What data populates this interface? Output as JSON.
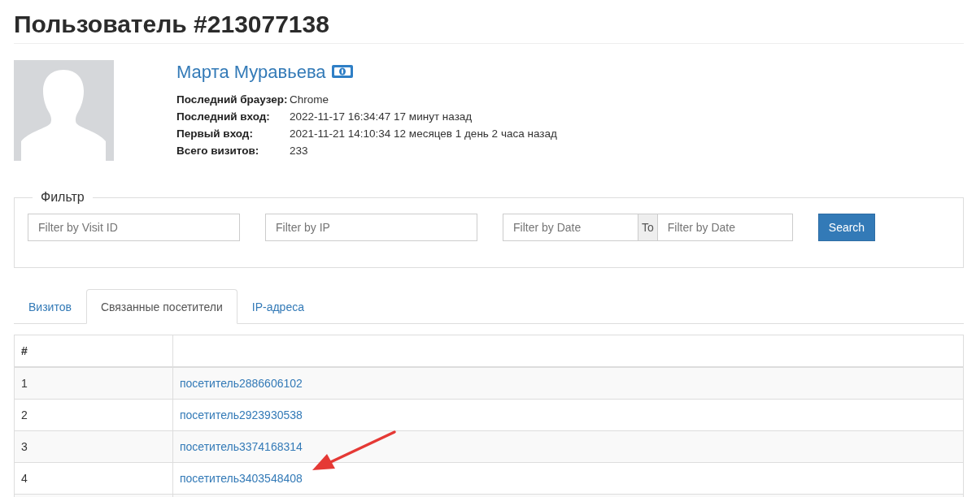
{
  "page_title": "Пользователь #213077138",
  "profile": {
    "name": "Марта Муравьева",
    "details": [
      {
        "label": "Последний браузер:",
        "value": "Chrome"
      },
      {
        "label": "Последний вход:",
        "value": "2022-11-17 16:34:47 17 минут назад"
      },
      {
        "label": "Первый вход:",
        "value": "2021-11-21 14:10:34 12 месяцев 1 день 2 часа назад"
      },
      {
        "label": "Всего визитов:",
        "value": "233"
      }
    ]
  },
  "filter": {
    "legend": "Фильтр",
    "visit_id": {
      "placeholder": "Filter by Visit ID"
    },
    "ip": {
      "placeholder": "Filter by IP"
    },
    "date_from": {
      "placeholder": "Filter by Date"
    },
    "range_separator": "To",
    "date_to": {
      "placeholder": "Filter by Date"
    },
    "search_button": "Search"
  },
  "tabs": [
    {
      "label": "Визитов",
      "selected": false
    },
    {
      "label": "Связанные посетители",
      "selected": true
    },
    {
      "label": "IP-адреса",
      "selected": false
    }
  ],
  "table": {
    "columns": [
      "#"
    ],
    "rows": [
      {
        "number": "1",
        "visitor": "посетитель2886606102"
      },
      {
        "number": "2",
        "visitor": "посетитель2923930538"
      },
      {
        "number": "3",
        "visitor": "посетитель3374168314"
      },
      {
        "number": "4",
        "visitor": "посетитель3403548408"
      }
    ]
  }
}
